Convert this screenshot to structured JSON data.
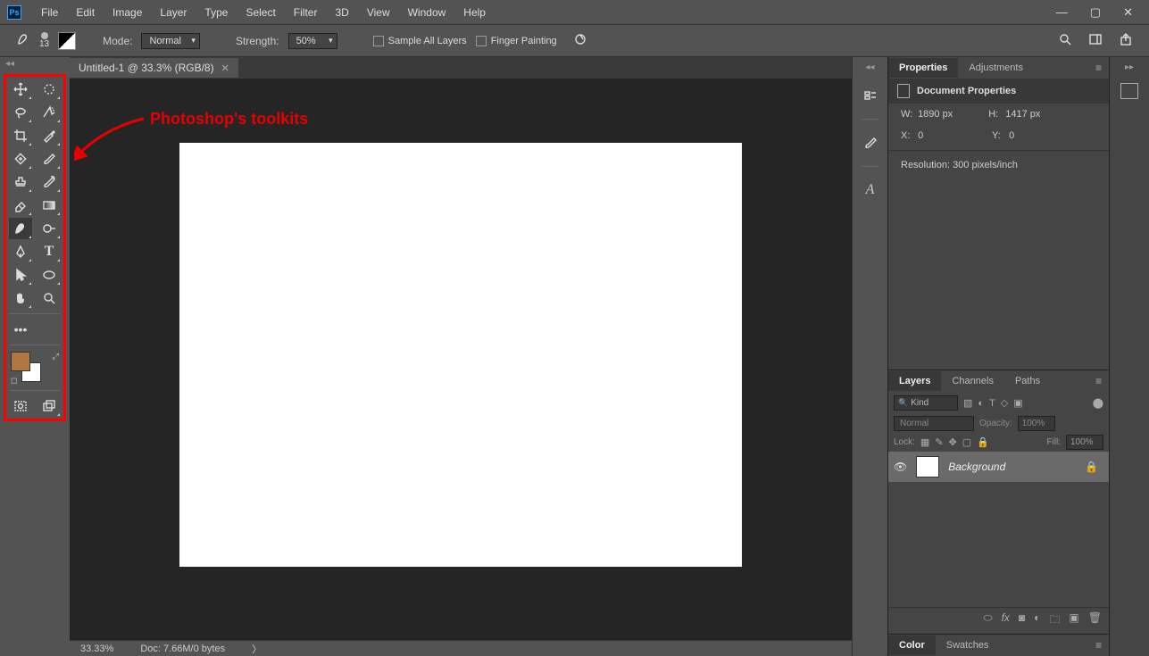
{
  "app": {
    "logo": "Ps"
  },
  "menu": [
    "File",
    "Edit",
    "Image",
    "Layer",
    "Type",
    "Select",
    "Filter",
    "3D",
    "View",
    "Window",
    "Help"
  ],
  "options": {
    "brush_size": "13",
    "mode_label": "Mode:",
    "mode_value": "Normal",
    "strength_label": "Strength:",
    "strength_value": "50%",
    "sample_all": "Sample All Layers",
    "finger_paint": "Finger Painting"
  },
  "doc_tab": "Untitled-1 @ 33.3% (RGB/8)",
  "annotation": "Photoshop's toolkits",
  "status": {
    "zoom": "33.33%",
    "doc": "Doc: 7.66M/0 bytes"
  },
  "properties": {
    "tab_props": "Properties",
    "tab_adj": "Adjustments",
    "title": "Document Properties",
    "w_label": "W:",
    "w_val": "1890 px",
    "h_label": "H:",
    "h_val": "1417 px",
    "x_label": "X:",
    "x_val": "0",
    "y_label": "Y:",
    "y_val": "0",
    "resolution": "Resolution: 300 pixels/inch"
  },
  "layers": {
    "tab_layers": "Layers",
    "tab_channels": "Channels",
    "tab_paths": "Paths",
    "filter": "Kind",
    "blend": "Normal",
    "opacity_lbl": "Opacity:",
    "opacity_val": "100%",
    "lock_lbl": "Lock:",
    "fill_lbl": "Fill:",
    "fill_val": "100%",
    "bg_layer": "Background"
  },
  "color": {
    "tab_color": "Color",
    "tab_swatches": "Swatches"
  },
  "swatch": {
    "fg": "#b07840",
    "bg": "#ffffff"
  }
}
